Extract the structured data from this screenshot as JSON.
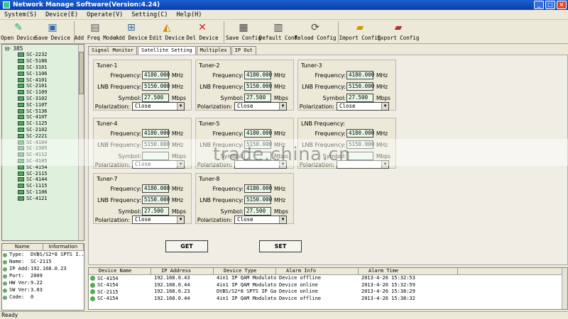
{
  "window": {
    "title": "Network Manage Software(Version:4.24)"
  },
  "menu": [
    "System(S)",
    "Device(E)",
    "Operate(V)",
    "Setting(C)",
    "Help(H)"
  ],
  "toolbar": [
    {
      "label": "Open Device",
      "icon": "open-device-icon"
    },
    {
      "label": "Save Device",
      "icon": "save-device-icon"
    },
    {
      "label": "Add Freq Mode",
      "icon": "add-freq-icon"
    },
    {
      "label": "Add Device",
      "icon": "add-device-icon"
    },
    {
      "label": "Edit Device",
      "icon": "edit-device-icon"
    },
    {
      "label": "Del Device",
      "icon": "delete-icon"
    },
    {
      "label": "Save Config",
      "icon": "save-config-icon"
    },
    {
      "label": "Default Conf",
      "icon": "default-conf-icon"
    },
    {
      "label": "Reload Config",
      "icon": "reload-icon"
    },
    {
      "label": "Import Config",
      "icon": "import-icon"
    },
    {
      "label": "Export Config",
      "icon": "export-icon"
    }
  ],
  "tree": {
    "root": "385",
    "items": [
      "SC-2232",
      "SC-5186",
      "SC-3101",
      "SC-1106",
      "SC-4101",
      "SC-2101",
      "SC-1109",
      "SC-3102",
      "SC-110T",
      "SC-5136",
      "SC-410T",
      "SC-1125",
      "SC-2102",
      "SC-2221",
      "SC-4104",
      "SC-2305",
      "SC-4112",
      "SC-4105",
      "SC-4154",
      "SC-2115",
      "SC-4144",
      "SC-1115",
      "SC-1106",
      "SC-4121"
    ]
  },
  "info": {
    "headers": [
      "Name",
      "Information"
    ],
    "rows": [
      {
        "k": "Type:",
        "v": "DVBS/S2*8 SPTS I..."
      },
      {
        "k": "Name:",
        "v": "SC-2115"
      },
      {
        "k": "IP Add:",
        "v": "192.168.0.23"
      },
      {
        "k": "Port:",
        "v": "2009"
      },
      {
        "k": "HW Ver:",
        "v": "9.22"
      },
      {
        "k": "SW Ver:",
        "v": "3.03"
      },
      {
        "k": "Code:",
        "v": "0"
      }
    ]
  },
  "tabs": [
    "Signal Monitor",
    "Satellite Setting",
    "Multiplex",
    "IP Out"
  ],
  "labels": {
    "frequency": "Frequency:",
    "lnb": "LNB Frequency:",
    "symbol": "Symbol:",
    "polarization": "Polarization:",
    "mhz": "MHz",
    "mbps": "Mbps"
  },
  "tuners": [
    {
      "name": "Tuner-1",
      "freq": "4180.000",
      "lnb": "5150.000",
      "symbol": "27.500",
      "pol": "Close"
    },
    {
      "name": "Tuner-2",
      "freq": "4180.000",
      "lnb": "5150.000",
      "symbol": "27.500",
      "pol": "Close"
    },
    {
      "name": "Tuner-3",
      "freq": "4180.000",
      "lnb": "5150.000",
      "symbol": "27.500",
      "pol": "Close"
    },
    {
      "name": "Tuner-4",
      "freq": "4180.000",
      "lnb": "5150.000",
      "symbol": "",
      "pol": "Close"
    },
    {
      "name": "Tuner-5",
      "freq": "4180.000",
      "lnb": "5150.000",
      "symbol": "",
      "pol": ""
    },
    {
      "name": "LNB Frequency:",
      "freq": "4180.000",
      "lnb": "5150.000",
      "symbol": "",
      "pol": ""
    },
    {
      "name": "Tuner-7",
      "freq": "4180.000",
      "lnb": "5150.000",
      "symbol": "27.500",
      "pol": "Close"
    },
    {
      "name": "Tuner-8",
      "freq": "4180.000",
      "lnb": "5150.000",
      "symbol": "27.500",
      "pol": "Close"
    }
  ],
  "buttons": {
    "get": "GET",
    "set": "SET"
  },
  "watermark": "trade.china.cn",
  "alarm": {
    "headers": [
      "Device Name",
      "IP Address",
      "Device Type",
      "Alarm Info",
      "Alarm Time"
    ],
    "rows": [
      [
        "SC-4154",
        "192.168.0.43",
        "4in1 IP QAM Modulato...",
        "Device offline",
        "2013-4-26 15:32:53"
      ],
      [
        "SC-4154",
        "192.168.0.44",
        "4in1 IP QAM Modulato...",
        "Device online",
        "2013-4-26 15:32:59"
      ],
      [
        "SC-2115",
        "192.168.0.23",
        "DVBS/S2*8 SPTS IP Ga...",
        "Device online",
        "2013-4-26 15:38:29"
      ],
      [
        "SC-4154",
        "192.168.0.44",
        "4in1 IP QAM Modulato...",
        "Device offline",
        "2013-4-26 15:38:32"
      ]
    ]
  },
  "status": "Ready"
}
